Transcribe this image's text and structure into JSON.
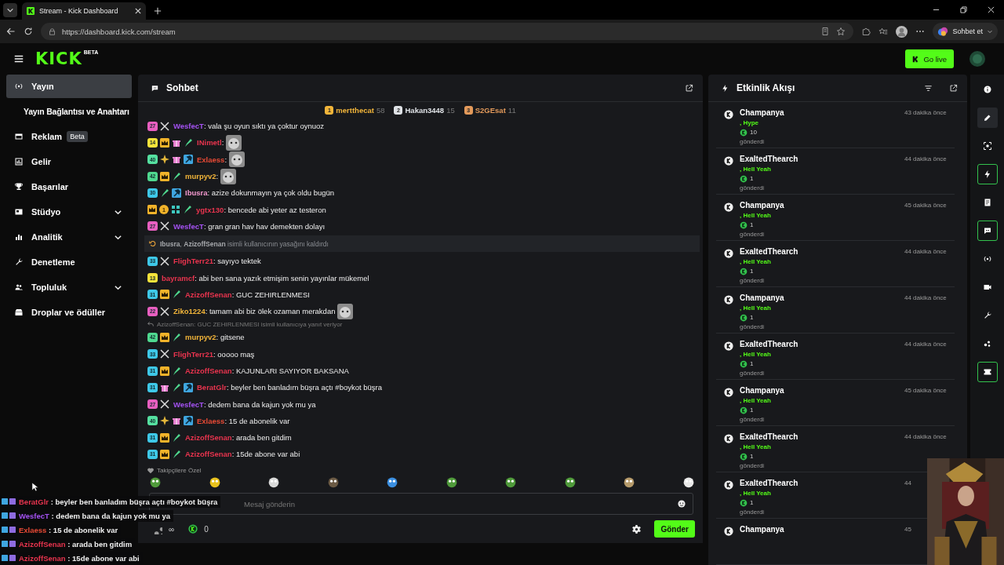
{
  "browser": {
    "tab_title": "Stream - Kick Dashboard",
    "url": "https://dashboard.kick.com/stream",
    "copilot_label": "Sohbet et"
  },
  "header": {
    "logo": "KICK",
    "logo_badge": "BETA",
    "go_live": "Go live"
  },
  "sidebar": {
    "items": [
      {
        "label": "Yayın",
        "selected": true,
        "children": [
          {
            "label": "Yayın Bağlantısı ve Anahtarı",
            "selected": false
          }
        ]
      },
      {
        "label": "Reklam",
        "badge": "Beta",
        "selected": false
      },
      {
        "label": "Gelir",
        "selected": false
      },
      {
        "label": "Başarılar",
        "selected": false
      },
      {
        "label": "Stüdyo",
        "selected": false,
        "expanded": false
      },
      {
        "label": "Analitik",
        "selected": false,
        "expanded": false
      },
      {
        "label": "Denetleme",
        "selected": false
      },
      {
        "label": "Topluluk",
        "selected": false,
        "expanded": false
      },
      {
        "label": "Droplar ve ödüller",
        "selected": false
      }
    ]
  },
  "chat": {
    "title": "Sohbet",
    "leaders": [
      {
        "rank": "1",
        "name": "mertthecat",
        "count": "58",
        "color": "#f2b53a"
      },
      {
        "rank": "2",
        "name": "Hakan3448",
        "count": "15",
        "color": "#dfe2e6"
      },
      {
        "rank": "3",
        "name": "S2GEsat",
        "count": "11",
        "color": "#e39a5b"
      }
    ],
    "items": [
      {
        "kind": "message",
        "user": "WesfecT",
        "color": "#a552f4",
        "badges": [
          {
            "kind": "months",
            "text": "27",
            "color": "#e85fc0"
          },
          {
            "kind": "swords"
          }
        ],
        "text": ": vala şu oyun sıktı ya çoktur oynuoz",
        "emote": false
      },
      {
        "kind": "message",
        "user": "INimetl",
        "color": "#e8344e",
        "badges": [
          {
            "kind": "months",
            "text": "14",
            "color": "#f5e33b"
          },
          {
            "kind": "crown"
          },
          {
            "kind": "gift"
          },
          {
            "kind": "brush"
          }
        ],
        "text": ":",
        "emote": true
      },
      {
        "kind": "message",
        "user": "Exlaess",
        "color": "#e84a35",
        "badges": [
          {
            "kind": "months",
            "text": "40",
            "color": "#55e0a0"
          },
          {
            "kind": "sparkle"
          },
          {
            "kind": "gift"
          },
          {
            "kind": "hammer"
          }
        ],
        "text": ":",
        "emote": true
      },
      {
        "kind": "message",
        "user": "murpyv2",
        "color": "#f2b53a",
        "badges": [
          {
            "kind": "months",
            "text": "42",
            "color": "#4fd88f"
          },
          {
            "kind": "crown"
          },
          {
            "kind": "brush"
          }
        ],
        "text": ":",
        "emote": true
      },
      {
        "kind": "message",
        "user": "Ibusra",
        "color": "#f59ad0",
        "badges": [
          {
            "kind": "months",
            "text": "30",
            "color": "#3ec8e8"
          },
          {
            "kind": "brush"
          },
          {
            "kind": "hammer"
          }
        ],
        "text": ": azize dokunmayın ya çok oldu bugün",
        "emote": false
      },
      {
        "kind": "message",
        "user": "ygtx130",
        "color": "#e8344e",
        "badges": [
          {
            "kind": "crown"
          },
          {
            "kind": "coin",
            "text": "1"
          },
          {
            "kind": "grid"
          },
          {
            "kind": "brush"
          }
        ],
        "text": ": bencede abi yeter az testeron",
        "emote": false
      },
      {
        "kind": "message",
        "user": "WesfecT",
        "color": "#a552f4",
        "badges": [
          {
            "kind": "months",
            "text": "27",
            "color": "#e85fc0"
          },
          {
            "kind": "swords"
          }
        ],
        "text": ": gran gran hav hav demekten dolayı",
        "emote": false
      },
      {
        "kind": "system",
        "text": "**Ibusra**, **AzizoffSenan** isimli kullanıcının yasağını kaldırdı"
      },
      {
        "kind": "message",
        "user": "FlighTerr21",
        "color": "#e8344e",
        "badges": [
          {
            "kind": "months",
            "text": "33",
            "color": "#3ec8e8"
          },
          {
            "kind": "swords"
          }
        ],
        "text": ": sayıyo tektek",
        "emote": false
      },
      {
        "kind": "message",
        "user": "bayramcf",
        "color": "#e8344e",
        "badges": [
          {
            "kind": "months",
            "text": "13",
            "color": "#f5e33b"
          }
        ],
        "text": ": abi ben sana yazık etmişim senin yayınlar mükemel",
        "emote": false
      },
      {
        "kind": "message",
        "user": "AzizoffSenan",
        "color": "#e8344e",
        "badges": [
          {
            "kind": "months",
            "text": "31",
            "color": "#3ec8e8"
          },
          {
            "kind": "crown"
          },
          {
            "kind": "brush"
          }
        ],
        "text": ": GUC ZEHIRLENMESI",
        "emote": false
      },
      {
        "kind": "message",
        "user": "Ziko1224",
        "color": "#f2b53a",
        "badges": [
          {
            "kind": "months",
            "text": "22",
            "color": "#e85fc0"
          },
          {
            "kind": "swords"
          }
        ],
        "text": ": tamam abi biz ölek ozaman merakdan",
        "emote": true
      },
      {
        "kind": "reply",
        "text": "AzizoffSenan: GUC ZEHIRLENMESI isimli kullanıcıya yanıt veriyor"
      },
      {
        "kind": "message",
        "user": "murpyv2",
        "color": "#f2b53a",
        "badges": [
          {
            "kind": "months",
            "text": "42",
            "color": "#4fd88f"
          },
          {
            "kind": "crown"
          },
          {
            "kind": "brush"
          }
        ],
        "text": ": gitsene",
        "emote": false
      },
      {
        "kind": "message",
        "user": "FlighTerr21",
        "color": "#e8344e",
        "badges": [
          {
            "kind": "months",
            "text": "33",
            "color": "#3ec8e8"
          },
          {
            "kind": "swords"
          }
        ],
        "text": ": ooooo maş",
        "emote": false
      },
      {
        "kind": "message",
        "user": "AzizoffSenan",
        "color": "#e8344e",
        "badges": [
          {
            "kind": "months",
            "text": "31",
            "color": "#3ec8e8"
          },
          {
            "kind": "crown"
          },
          {
            "kind": "brush"
          }
        ],
        "text": ": KAJUNLARI SAYIYOR BAKSANA",
        "emote": false
      },
      {
        "kind": "message",
        "user": "BeratGlr",
        "color": "#e8344e",
        "badges": [
          {
            "kind": "months",
            "text": "31",
            "color": "#3ec8e8"
          },
          {
            "kind": "gift"
          },
          {
            "kind": "brush"
          },
          {
            "kind": "hammer"
          }
        ],
        "text": ": beyler ben banladım büşra açtı #boykot büşra",
        "emote": false
      },
      {
        "kind": "message",
        "user": "WesfecT",
        "color": "#a552f4",
        "badges": [
          {
            "kind": "months",
            "text": "27",
            "color": "#e85fc0"
          },
          {
            "kind": "swords"
          }
        ],
        "text": ": dedem bana da kajun yok mu ya",
        "emote": false
      },
      {
        "kind": "message",
        "user": "Exlaess",
        "color": "#e84a35",
        "badges": [
          {
            "kind": "months",
            "text": "40",
            "color": "#55e0a0"
          },
          {
            "kind": "sparkle"
          },
          {
            "kind": "gift"
          },
          {
            "kind": "hammer"
          }
        ],
        "text": ": 15 de abonelik var",
        "emote": false
      },
      {
        "kind": "message",
        "user": "AzizoffSenan",
        "color": "#e8344e",
        "badges": [
          {
            "kind": "months",
            "text": "31",
            "color": "#3ec8e8"
          },
          {
            "kind": "crown"
          },
          {
            "kind": "brush"
          }
        ],
        "text": ": arada ben gitdim",
        "emote": false
      },
      {
        "kind": "message",
        "user": "AzizoffSenan",
        "color": "#e8344e",
        "badges": [
          {
            "kind": "months",
            "text": "31",
            "color": "#3ec8e8"
          },
          {
            "kind": "crown"
          },
          {
            "kind": "brush"
          }
        ],
        "text": ": 15de abone var abi",
        "emote": false
      }
    ],
    "emote_bar_label": "Takipçilere Özel",
    "placeholder": "Mesaj gönderin",
    "points": "∞",
    "kicks": "0",
    "send": "Gönder"
  },
  "events": {
    "title": "Etkinlik Akışı",
    "items": [
      {
        "name": "Champanya",
        "gift": ", Hype",
        "amount": "10",
        "sent": "gönderdi",
        "time": "43 dakika önce"
      },
      {
        "name": "ExaltedThearch",
        "gift": ", Hell Yeah",
        "amount": "1",
        "sent": "gönderdi",
        "time": "44 dakika önce"
      },
      {
        "name": "Champanya",
        "gift": ", Hell Yeah",
        "amount": "1",
        "sent": "gönderdi",
        "time": "45 dakika önce"
      },
      {
        "name": "ExaltedThearch",
        "gift": ", Hell Yeah",
        "amount": "1",
        "sent": "gönderdi",
        "time": "44 dakika önce"
      },
      {
        "name": "Champanya",
        "gift": ", Hell Yeah",
        "amount": "1",
        "sent": "gönderdi",
        "time": "44 dakika önce"
      },
      {
        "name": "ExaltedThearch",
        "gift": ", Hell Yeah",
        "amount": "1",
        "sent": "gönderdi",
        "time": "44 dakika önce"
      },
      {
        "name": "Champanya",
        "gift": ", Hell Yeah",
        "amount": "1",
        "sent": "gönderdi",
        "time": "45 dakika önce"
      },
      {
        "name": "ExaltedThearch",
        "gift": ", Hell Yeah",
        "amount": "1",
        "sent": "gönderdi",
        "time": "44 dakika önce"
      },
      {
        "name": "ExaltedThearch",
        "gift": ", Hell Yeah",
        "amount": "1",
        "sent": "gönderdi",
        "time": "44"
      },
      {
        "name": "Champanya",
        "time": "45"
      }
    ]
  },
  "rail": [
    {
      "active": false,
      "hovered": false
    },
    {
      "active": false,
      "hovered": true
    },
    {
      "active": false,
      "hovered": false
    },
    {
      "active": true,
      "hovered": false
    },
    {
      "active": false,
      "hovered": false
    },
    {
      "active": true,
      "hovered": false
    },
    {
      "active": false,
      "hovered": false
    },
    {
      "active": false,
      "hovered": false
    },
    {
      "active": false,
      "hovered": false
    },
    {
      "active": false,
      "hovered": false
    },
    {
      "active": true,
      "hovered": false
    }
  ],
  "overlay_chat": [
    {
      "user": "BeratGlr",
      "color": "#e8344e",
      "text": ": beyler ben banladım büşra açtı #boykot büşra"
    },
    {
      "user": "WesfecT",
      "color": "#a552f4",
      "text": ": dedem bana da kajun yok mu ya"
    },
    {
      "user": "Exlaess",
      "color": "#e84a35",
      "text": ": 15 de abonelik var"
    },
    {
      "user": "AzizoffSenan",
      "color": "#e8344e",
      "text": ": arada ben gitdim"
    },
    {
      "user": "AzizoffSenan",
      "color": "#e8344e",
      "text": ": 15de abone var abi"
    }
  ]
}
